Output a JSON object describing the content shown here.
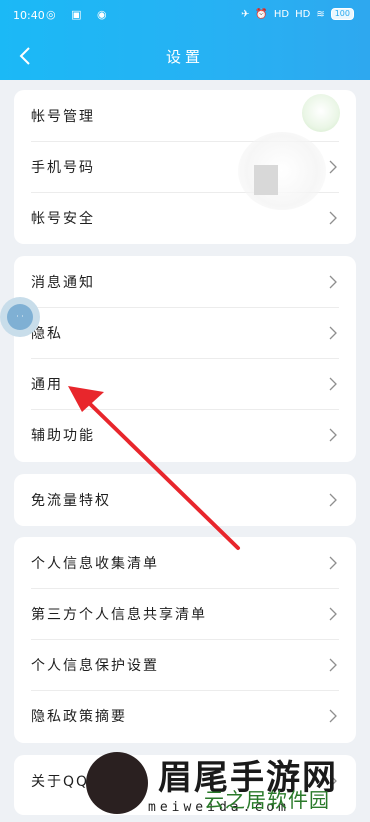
{
  "status_bar": {
    "time": "10:40",
    "left_icons": "◎ ▣ ◉",
    "signal1": "HD",
    "signal2": "HD",
    "battery": "100"
  },
  "header": {
    "title": "设置"
  },
  "groups": [
    {
      "items": [
        "帐号管理",
        "手机号码",
        "帐号安全"
      ]
    },
    {
      "items": [
        "消息通知",
        "隐私",
        "通用",
        "辅助功能"
      ]
    },
    {
      "items": [
        "免流量特权"
      ]
    },
    {
      "items": [
        "个人信息收集清单",
        "第三方个人信息共享清单",
        "个人信息保护设置",
        "隐私政策摘要"
      ]
    },
    {
      "items": [
        "关于QQ与帮助"
      ]
    }
  ],
  "watermark": {
    "brand": "眉尾手游网",
    "domain": "meiweida.com",
    "brand2": "云之居软件园"
  },
  "colors": {
    "header_start": "#1bb9f6",
    "header_end": "#2ea8ef",
    "arrow": "#e8262c",
    "background": "#eef1f5"
  },
  "icons": {
    "back": "back-arrow-icon",
    "chevron": "chevron-right-icon",
    "float": "floating-assist-ball-icon"
  }
}
